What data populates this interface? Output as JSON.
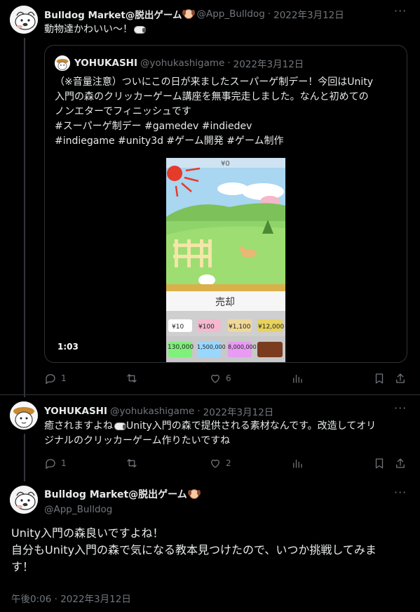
{
  "tweet1": {
    "display_name": "Bulldog Market@脱出ゲーム",
    "handle": "@App_Bulldog",
    "sep": "·",
    "date": "2022年3月12日",
    "more": "···",
    "text": "動物達かわいい〜！",
    "quote": {
      "display_name": "YOHUKASHI",
      "handle": "@yohukashigame",
      "sep": "·",
      "date": "2022年3月12日",
      "lines": [
        "（※音量注意）ついにこの日が来ましたスーパーゲ制デー！今回はUnity",
        "入門の森のクリッカーゲーム講座を無事完走しました。なんと初めての",
        "ノンエターでフィニッシュです",
        "#スーパーゲ制デー  #gamedev  #indiedev",
        "#indiegame #unity3d  #ゲーム開発 #ゲーム制作"
      ],
      "video_duration": "1:03",
      "game": {
        "score": "¥0",
        "sell_button": "売却",
        "prices_row1": [
          "¥10",
          "¥100",
          "¥1,100",
          "¥12,000"
        ],
        "prices_row2": [
          "130,000",
          "1,500,000",
          "8,000,000",
          ""
        ]
      }
    },
    "actions": {
      "reply": "1",
      "retweet": "",
      "like": "6",
      "views": ""
    }
  },
  "tweet2": {
    "display_name": "YOHUKASHI",
    "handle": "@yohukashigame",
    "sep": "·",
    "date": "2022年3月12日",
    "more": "···",
    "line1_a": "癒されますよね",
    "line1_b": "Unity入門の森で提供される素材なんです。改造してオリ",
    "line2": "ジナルのクリッカーゲーム作りたいですね",
    "actions": {
      "reply": "1",
      "retweet": "",
      "like": "2",
      "views": ""
    }
  },
  "main": {
    "display_name": "Bulldog Market@脱出ゲーム",
    "handle": "@App_Bulldog",
    "more": "···",
    "lines": [
      "Unity入門の森良いですよね！",
      "自分もUnity入門の森で気になる教本見つけたので、いつか挑戦してみま",
      "す！"
    ],
    "timestamp": "午後0:06 · 2022年3月12日"
  }
}
